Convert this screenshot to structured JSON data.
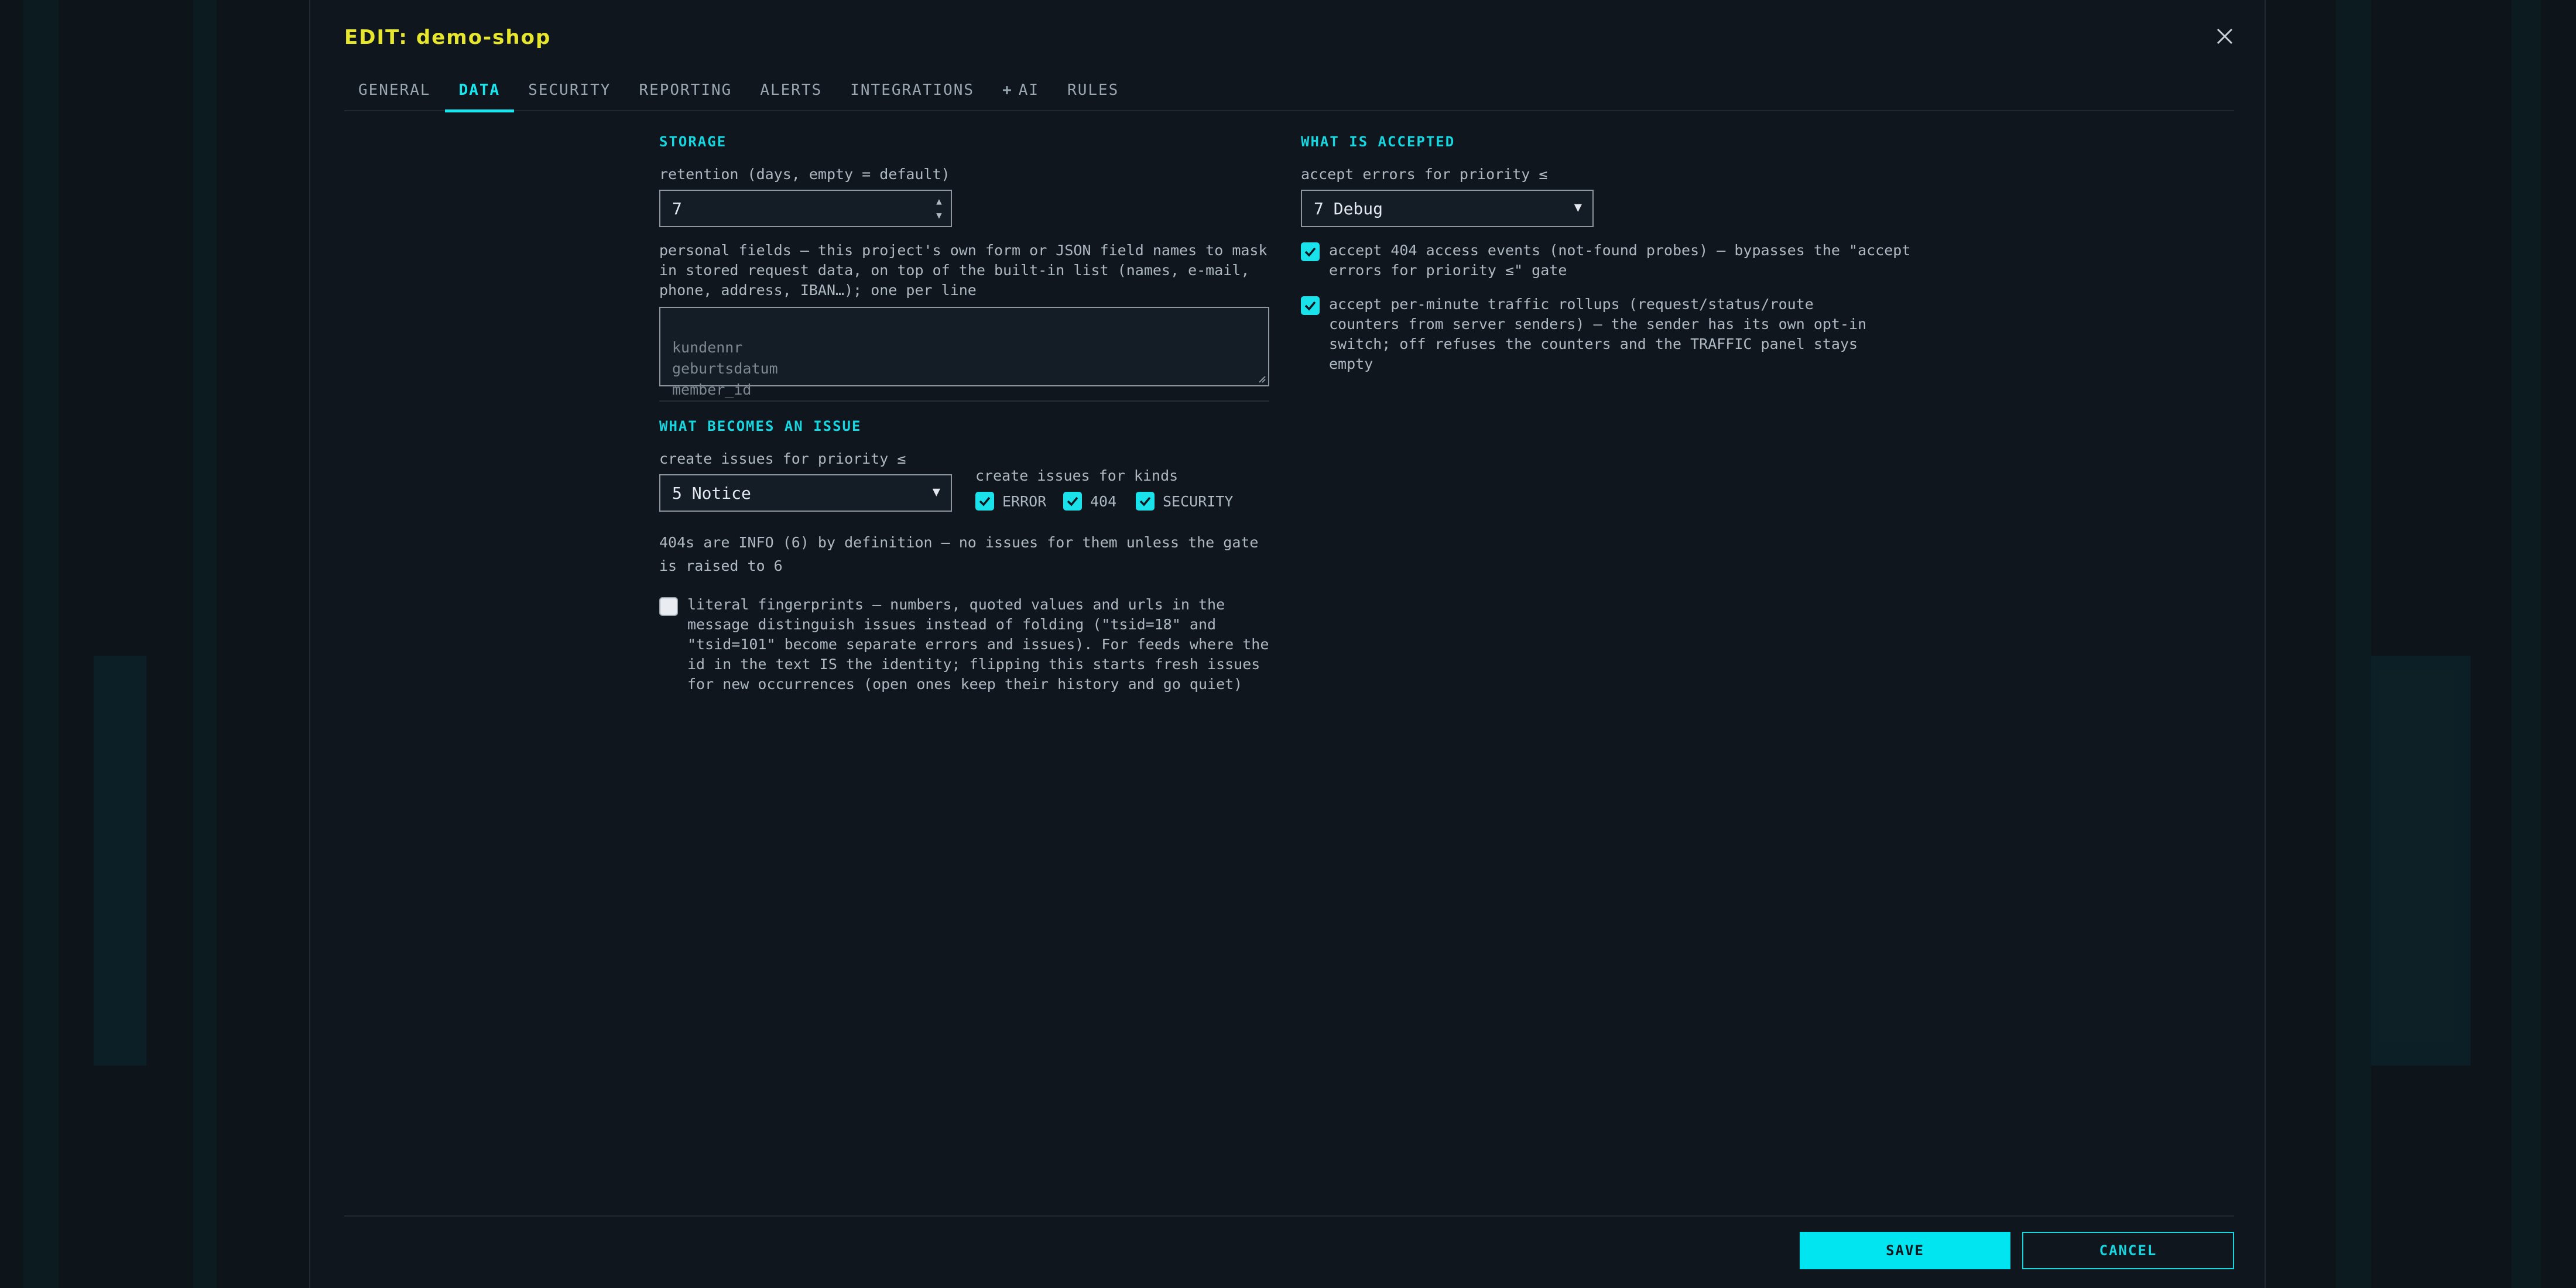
{
  "dialog": {
    "title": "EDIT: demo-shop"
  },
  "tabs": [
    {
      "label": "GENERAL"
    },
    {
      "label": "DATA"
    },
    {
      "label": "SECURITY"
    },
    {
      "label": "REPORTING"
    },
    {
      "label": "ALERTS"
    },
    {
      "label": "INTEGRATIONS"
    },
    {
      "label": "AI",
      "icon": "plus-icon"
    },
    {
      "label": "RULES"
    }
  ],
  "active_tab": "DATA",
  "storage": {
    "title": "STORAGE",
    "retention_label": "retention (days, empty = default)",
    "retention_value": "7",
    "personal_fields_label": "personal fields — this project's own form or JSON field names to mask in stored request data, on top of the built-in list (names, e-mail, phone, address, IBAN…); one per line",
    "personal_fields_placeholder": "kundennr\ngeburtsdatum\nmember_id"
  },
  "issue": {
    "title": "WHAT BECOMES AN ISSUE",
    "priority_label": "create issues for priority ≤",
    "priority_value": "5 Notice",
    "kinds_label": "create issues for kinds",
    "kinds": [
      {
        "label": "ERROR",
        "checked": true
      },
      {
        "label": "404",
        "checked": true
      },
      {
        "label": "SECURITY",
        "checked": true
      }
    ],
    "note": "404s are INFO (6) by definition — no issues for them unless the gate is raised to 6",
    "literal_fingerprints": {
      "checked": false,
      "label": "literal fingerprints — numbers, quoted values and urls in the message distinguish issues instead of folding (\"tsid=18\" and \"tsid=101\" become separate errors and issues). For feeds where the id in the text IS the identity; flipping this starts fresh issues for new occurrences (open ones keep their history and go quiet)"
    }
  },
  "accepted": {
    "title": "WHAT IS ACCEPTED",
    "priority_label": "accept errors for priority ≤",
    "priority_value": "7 Debug",
    "accept_404": {
      "checked": true,
      "label": "accept 404 access events (not-found probes) — bypasses the \"accept errors for priority ≤\" gate"
    },
    "accept_rollups": {
      "checked": true,
      "label": "accept per-minute traffic rollups (request/status/route counters from server senders) — the sender has its own opt-in switch; off refuses the counters and the TRAFFIC panel stays empty"
    }
  },
  "footer": {
    "save_label": "SAVE",
    "cancel_label": "CANCEL"
  },
  "colors": {
    "accent": "#18e6ef",
    "title": "#e6e62e",
    "background": "#0f161e"
  }
}
